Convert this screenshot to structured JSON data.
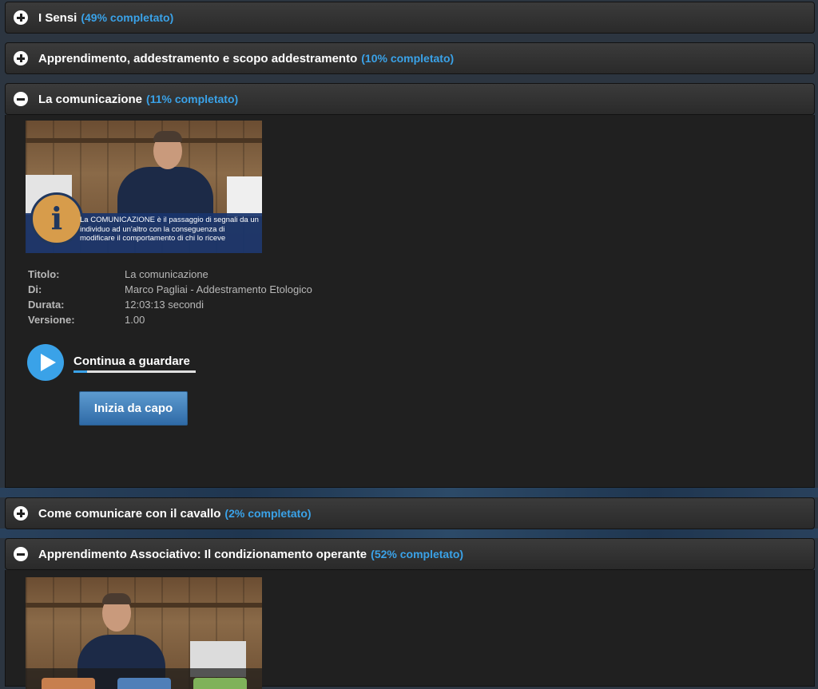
{
  "colors": {
    "accent": "#3aa2e8",
    "header_bg": "#333333",
    "panel_bg": "#202020",
    "button_blue": "#3f7fbd"
  },
  "sections": [
    {
      "title": "I Sensi",
      "progress": "(49% completato)",
      "toggle_icon": "plus-icon"
    },
    {
      "title": "Apprendimento, addestramento e scopo addestramento",
      "progress": "(10% completato)",
      "toggle_icon": "plus-icon"
    },
    {
      "title": "La comunicazione",
      "progress": "(11% completato)",
      "toggle_icon": "minus-icon",
      "lesson": {
        "caption": "La COMUNICAZIONE è il passaggio di segnali da un individuo ad un'altro con la conseguenza di modificare il comportamento di chi lo riceve",
        "info_icon_glyph": "i",
        "details": [
          {
            "label": "Titolo:",
            "value": "La comunicazione"
          },
          {
            "label": "Di:",
            "value": "Marco Pagliai - Addestramento Etologico"
          },
          {
            "label": "Durata:",
            "value": "12:03:13 secondi"
          },
          {
            "label": "Versione:",
            "value": "1.00"
          }
        ],
        "continue_label": "Continua a guardare",
        "watch_progress": 0.11,
        "restart_label": "Inizia da capo"
      }
    },
    {
      "title": "Come comunicare con il cavallo",
      "progress": "(2% completato)",
      "toggle_icon": "plus-icon"
    },
    {
      "title": "Apprendimento Associativo: Il condizionamento operante",
      "progress": "(52% completato)",
      "toggle_icon": "minus-icon"
    }
  ]
}
